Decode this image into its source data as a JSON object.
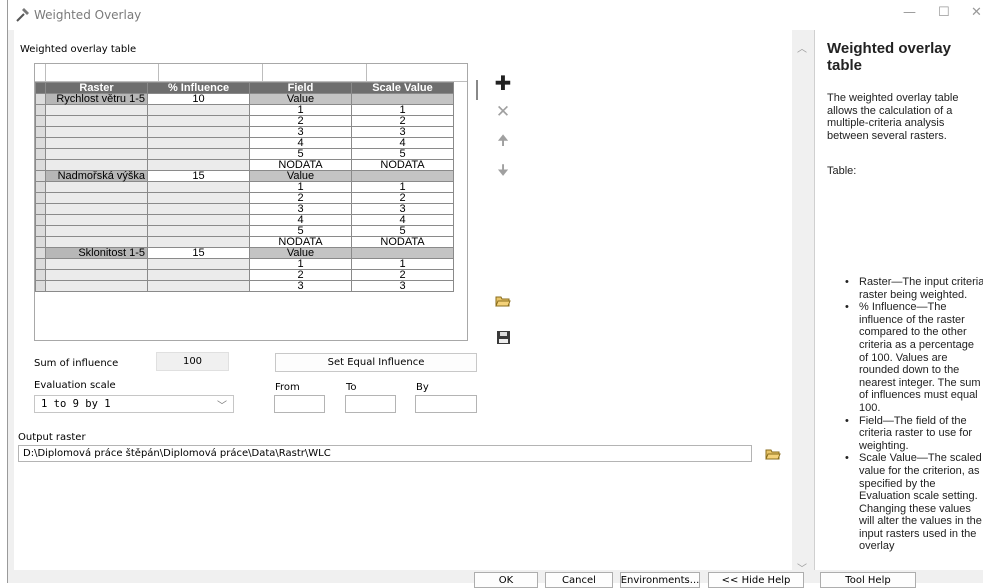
{
  "window": {
    "title": "Weighted Overlay",
    "controls": {
      "minimize": "—",
      "maximize": "☐",
      "close": "✕"
    }
  },
  "main": {
    "table_label": "Weighted overlay table",
    "columns": [
      "Raster",
      "% Influence",
      "Field",
      "Scale Value"
    ],
    "rows": [
      {
        "raster": "Rychlost větru 1-5",
        "influence": "10",
        "field": "Value",
        "scale": "",
        "header": true
      },
      {
        "raster": "",
        "influence": "",
        "field": "1",
        "scale": "1"
      },
      {
        "raster": "",
        "influence": "",
        "field": "2",
        "scale": "2"
      },
      {
        "raster": "",
        "influence": "",
        "field": "3",
        "scale": "3"
      },
      {
        "raster": "",
        "influence": "",
        "field": "4",
        "scale": "4"
      },
      {
        "raster": "",
        "influence": "",
        "field": "5",
        "scale": "5"
      },
      {
        "raster": "",
        "influence": "",
        "field": "NODATA",
        "scale": "NODATA"
      },
      {
        "raster": "Nadmořská výška",
        "influence": "15",
        "field": "Value",
        "scale": "",
        "header": true
      },
      {
        "raster": "",
        "influence": "",
        "field": "1",
        "scale": "1"
      },
      {
        "raster": "",
        "influence": "",
        "field": "2",
        "scale": "2"
      },
      {
        "raster": "",
        "influence": "",
        "field": "3",
        "scale": "3"
      },
      {
        "raster": "",
        "influence": "",
        "field": "4",
        "scale": "4"
      },
      {
        "raster": "",
        "influence": "",
        "field": "5",
        "scale": "5"
      },
      {
        "raster": "",
        "influence": "",
        "field": "NODATA",
        "scale": "NODATA"
      },
      {
        "raster": "Sklonitost 1-5",
        "influence": "15",
        "field": "Value",
        "scale": "",
        "header": true
      },
      {
        "raster": "",
        "influence": "",
        "field": "1",
        "scale": "1"
      },
      {
        "raster": "",
        "influence": "",
        "field": "2",
        "scale": "2"
      },
      {
        "raster": "",
        "influence": "",
        "field": "3",
        "scale": "3"
      }
    ],
    "tools": {
      "add": "add-icon",
      "remove": "remove-icon",
      "move_up": "arrow-up-icon",
      "move_down": "arrow-down-icon",
      "open": "open-folder-icon",
      "save": "save-icon"
    },
    "sum_label": "Sum of influence",
    "sum_value": "100",
    "equal_button": "Set Equal Influence",
    "eval_label": "Evaluation scale",
    "eval_value": "1 to 9 by 1",
    "from_label": "From",
    "to_label": "To",
    "by_label": "By",
    "output_label": "Output raster",
    "output_value": "D:\\Diplomová práce štěpán\\Diplomová práce\\Data\\Rastr\\WLC"
  },
  "help": {
    "title": "Weighted overlay table",
    "intro": "The weighted overlay table allows the calculation of a multiple-criteria analysis between several rasters.",
    "table_label": "Table:",
    "bullets": [
      "Raster—The input criteria raster being weighted.",
      "% Influence—The influence of the raster compared to the other criteria as a percentage of 100. Values are rounded down to the nearest integer. The sum of influences must equal 100.",
      "Field—The field of the criteria raster to use for weighting.",
      "Scale Value—The scaled value for the criterion, as specified by the Evaluation scale setting. Changing these values will alter the values in the input rasters used in the overlay"
    ]
  },
  "footer": {
    "ok": "OK",
    "cancel": "Cancel",
    "environments": "Environments...",
    "hide_help": "<< Hide Help",
    "tool_help": "Tool Help"
  }
}
